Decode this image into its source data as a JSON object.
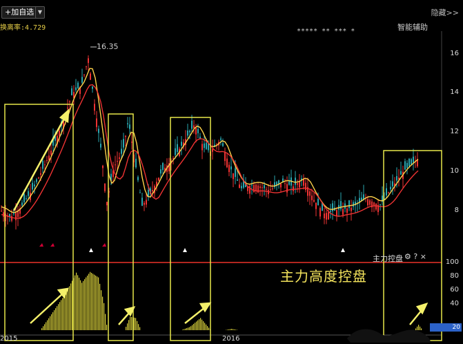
{
  "toolbar": {
    "add_watchlist": "+加自选",
    "dropdown": "▼",
    "hide": "隐藏>>"
  },
  "header": {
    "ratio_text": "换离率:4.729",
    "smart_assist": "智能辅助",
    "stars": "***** ** ***  *"
  },
  "chart": {
    "peak_label": "16.35",
    "price_axis": [
      "16",
      "14",
      "12",
      "10",
      "8"
    ],
    "indicator_axis": [
      "100",
      "80",
      "60",
      "40",
      "20"
    ],
    "indicator_title": "主力控盘",
    "indicator_icons": "⚙ ? ×",
    "annotation": "主力高度控盘",
    "x_labels": [
      "2015",
      "2016"
    ],
    "tag_value": "20"
  },
  "chart_data": {
    "type": "candlestick+histogram",
    "price_ylim": [
      6.5,
      17
    ],
    "peak_value": 16.35,
    "indicator_ylim": [
      0,
      100
    ],
    "colors": {
      "up": "#e33",
      "down": "#2aa7b0",
      "ma_short": "#ffd24a",
      "ma_long": "#e33",
      "indicator": "#d8cf3a",
      "boxes": "#e7e74a",
      "arrows": "#f4f06a"
    }
  }
}
